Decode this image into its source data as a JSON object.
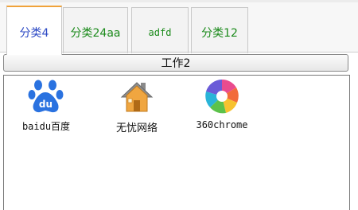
{
  "tabs": [
    {
      "label": "分类4"
    },
    {
      "label": "分类24aa"
    },
    {
      "label": "adfd"
    },
    {
      "label": "分类12"
    }
  ],
  "section": {
    "title": "工作2"
  },
  "items": [
    {
      "label": "baidu百度",
      "icon": "baidu-paw-icon"
    },
    {
      "label": "无忧网络",
      "icon": "house-icon"
    },
    {
      "label": "360chrome",
      "icon": "360chrome-icon"
    }
  ],
  "colors": {
    "active_tab_text": "#2c49c4",
    "tab_text": "#1a8a1a",
    "active_tab_accent": "#f0a23a",
    "baidu_blue": "#2a72e0"
  }
}
